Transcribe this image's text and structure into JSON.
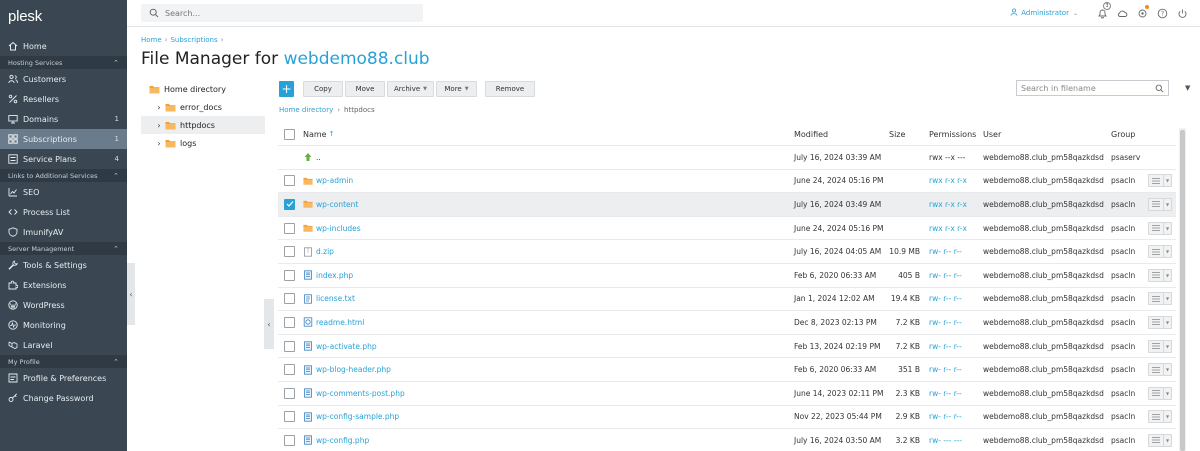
{
  "brand": {
    "logo_text": "plesk"
  },
  "search": {
    "placeholder": "Search..."
  },
  "user": {
    "name": "Administrator",
    "notifications_count": "3"
  },
  "sidebar": {
    "home": "Home",
    "sections": [
      {
        "title": "Hosting Services",
        "items": [
          {
            "label": "Customers",
            "icon": "users-icon",
            "count": ""
          },
          {
            "label": "Resellers",
            "icon": "percent-icon",
            "count": ""
          },
          {
            "label": "Domains",
            "icon": "monitor-icon",
            "count": "1"
          },
          {
            "label": "Subscriptions",
            "icon": "grid-icon",
            "count": "1",
            "active": true
          },
          {
            "label": "Service Plans",
            "icon": "list-icon",
            "count": "4"
          }
        ]
      },
      {
        "title": "Links to Additional Services",
        "items": [
          {
            "label": "SEO",
            "icon": "chart-icon",
            "count": ""
          },
          {
            "label": "Process List",
            "icon": "code-icon",
            "count": ""
          },
          {
            "label": "ImunifyAV",
            "icon": "shield-icon",
            "count": ""
          }
        ]
      },
      {
        "title": "Server Management",
        "items": [
          {
            "label": "Tools & Settings",
            "icon": "tools-icon",
            "count": ""
          },
          {
            "label": "Extensions",
            "icon": "puzzle-icon",
            "count": ""
          },
          {
            "label": "WordPress",
            "icon": "wordpress-icon",
            "count": ""
          },
          {
            "label": "Monitoring",
            "icon": "monitoring-icon",
            "count": ""
          },
          {
            "label": "Laravel",
            "icon": "laravel-icon",
            "count": ""
          }
        ]
      },
      {
        "title": "My Profile",
        "items": [
          {
            "label": "Profile & Preferences",
            "icon": "profile-icon",
            "count": ""
          },
          {
            "label": "Change Password",
            "icon": "key-icon",
            "count": ""
          }
        ]
      }
    ]
  },
  "breadcrumb": {
    "home": "Home",
    "subscriptions": "Subscriptions"
  },
  "title": {
    "prefix": "File Manager for ",
    "domain": "webdemo88.club"
  },
  "tree": {
    "root": "Home directory",
    "children": [
      "error_docs",
      "httpdocs",
      "logs"
    ]
  },
  "toolbar": {
    "add": "+",
    "copy": "Copy",
    "move": "Move",
    "archive": "Archive",
    "more": "More",
    "remove": "Remove",
    "search_placeholder": "Search in filename"
  },
  "path": {
    "root": "Home directory",
    "current": "httpdocs"
  },
  "table": {
    "columns": {
      "name": "Name",
      "sort": "↑",
      "modified": "Modified",
      "size": "Size",
      "permissions": "Permissions",
      "user": "User",
      "group": "Group"
    },
    "rows": [
      {
        "name": "..",
        "type": "up",
        "modified": "July 16, 2024 03:39 AM",
        "size": "",
        "permissions": "rwx --x ---",
        "user": "webdemo88.club_pm58qazkdsd",
        "group": "psaserv",
        "checkbox": false,
        "checked": false,
        "perm_link": false
      },
      {
        "name": "wp-admin",
        "type": "folder",
        "modified": "June 24, 2024 05:16 PM",
        "size": "",
        "permissions": "rwx r-x r-x",
        "user": "webdemo88.club_pm58qazkdsd",
        "group": "psacln",
        "checkbox": true,
        "checked": false,
        "perm_link": true
      },
      {
        "name": "wp-content",
        "type": "folder",
        "modified": "July 16, 2024 03:49 AM",
        "size": "",
        "permissions": "rwx r-x r-x",
        "user": "webdemo88.club_pm58qazkdsd",
        "group": "psacln",
        "checkbox": true,
        "checked": true,
        "perm_link": true
      },
      {
        "name": "wp-includes",
        "type": "folder",
        "modified": "June 24, 2024 05:16 PM",
        "size": "",
        "permissions": "rwx r-x r-x",
        "user": "webdemo88.club_pm58qazkdsd",
        "group": "psacln",
        "checkbox": true,
        "checked": false,
        "perm_link": true
      },
      {
        "name": "d.zip",
        "type": "zip",
        "modified": "July 16, 2024 04:05 AM",
        "size": "10.9 MB",
        "permissions": "rw- r-- r--",
        "user": "webdemo88.club_pm58qazkdsd",
        "group": "psacln",
        "checkbox": true,
        "checked": false,
        "perm_link": true
      },
      {
        "name": "index.php",
        "type": "php",
        "modified": "Feb 6, 2020 06:33 AM",
        "size": "405 B",
        "permissions": "rw- r-- r--",
        "user": "webdemo88.club_pm58qazkdsd",
        "group": "psacln",
        "checkbox": true,
        "checked": false,
        "perm_link": true
      },
      {
        "name": "license.txt",
        "type": "txt",
        "modified": "Jan 1, 2024 12:02 AM",
        "size": "19.4 KB",
        "permissions": "rw- r-- r--",
        "user": "webdemo88.club_pm58qazkdsd",
        "group": "psacln",
        "checkbox": true,
        "checked": false,
        "perm_link": true
      },
      {
        "name": "readme.html",
        "type": "html",
        "modified": "Dec 8, 2023 02:13 PM",
        "size": "7.2 KB",
        "permissions": "rw- r-- r--",
        "user": "webdemo88.club_pm58qazkdsd",
        "group": "psacln",
        "checkbox": true,
        "checked": false,
        "perm_link": true
      },
      {
        "name": "wp-activate.php",
        "type": "php",
        "modified": "Feb 13, 2024 02:19 PM",
        "size": "7.2 KB",
        "permissions": "rw- r-- r--",
        "user": "webdemo88.club_pm58qazkdsd",
        "group": "psacln",
        "checkbox": true,
        "checked": false,
        "perm_link": true
      },
      {
        "name": "wp-blog-header.php",
        "type": "php",
        "modified": "Feb 6, 2020 06:33 AM",
        "size": "351 B",
        "permissions": "rw- r-- r--",
        "user": "webdemo88.club_pm58qazkdsd",
        "group": "psacln",
        "checkbox": true,
        "checked": false,
        "perm_link": true
      },
      {
        "name": "wp-comments-post.php",
        "type": "php",
        "modified": "June 14, 2023 02:11 PM",
        "size": "2.3 KB",
        "permissions": "rw- r-- r--",
        "user": "webdemo88.club_pm58qazkdsd",
        "group": "psacln",
        "checkbox": true,
        "checked": false,
        "perm_link": true
      },
      {
        "name": "wp-config-sample.php",
        "type": "php",
        "modified": "Nov 22, 2023 05:44 PM",
        "size": "2.9 KB",
        "permissions": "rw- r-- r--",
        "user": "webdemo88.club_pm58qazkdsd",
        "group": "psacln",
        "checkbox": true,
        "checked": false,
        "perm_link": true
      },
      {
        "name": "wp-config.php",
        "type": "php",
        "modified": "July 16, 2024 03:50 AM",
        "size": "3.2 KB",
        "permissions": "rw- --- ---",
        "user": "webdemo88.club_pm58qazkdsd",
        "group": "psacln",
        "checkbox": true,
        "checked": false,
        "perm_link": true
      }
    ]
  },
  "colors": {
    "accent": "#28a2d6",
    "sidebar_bg": "#3a4753",
    "sidebar_active": "#6a7c8b",
    "folder": "#f39c3a"
  }
}
